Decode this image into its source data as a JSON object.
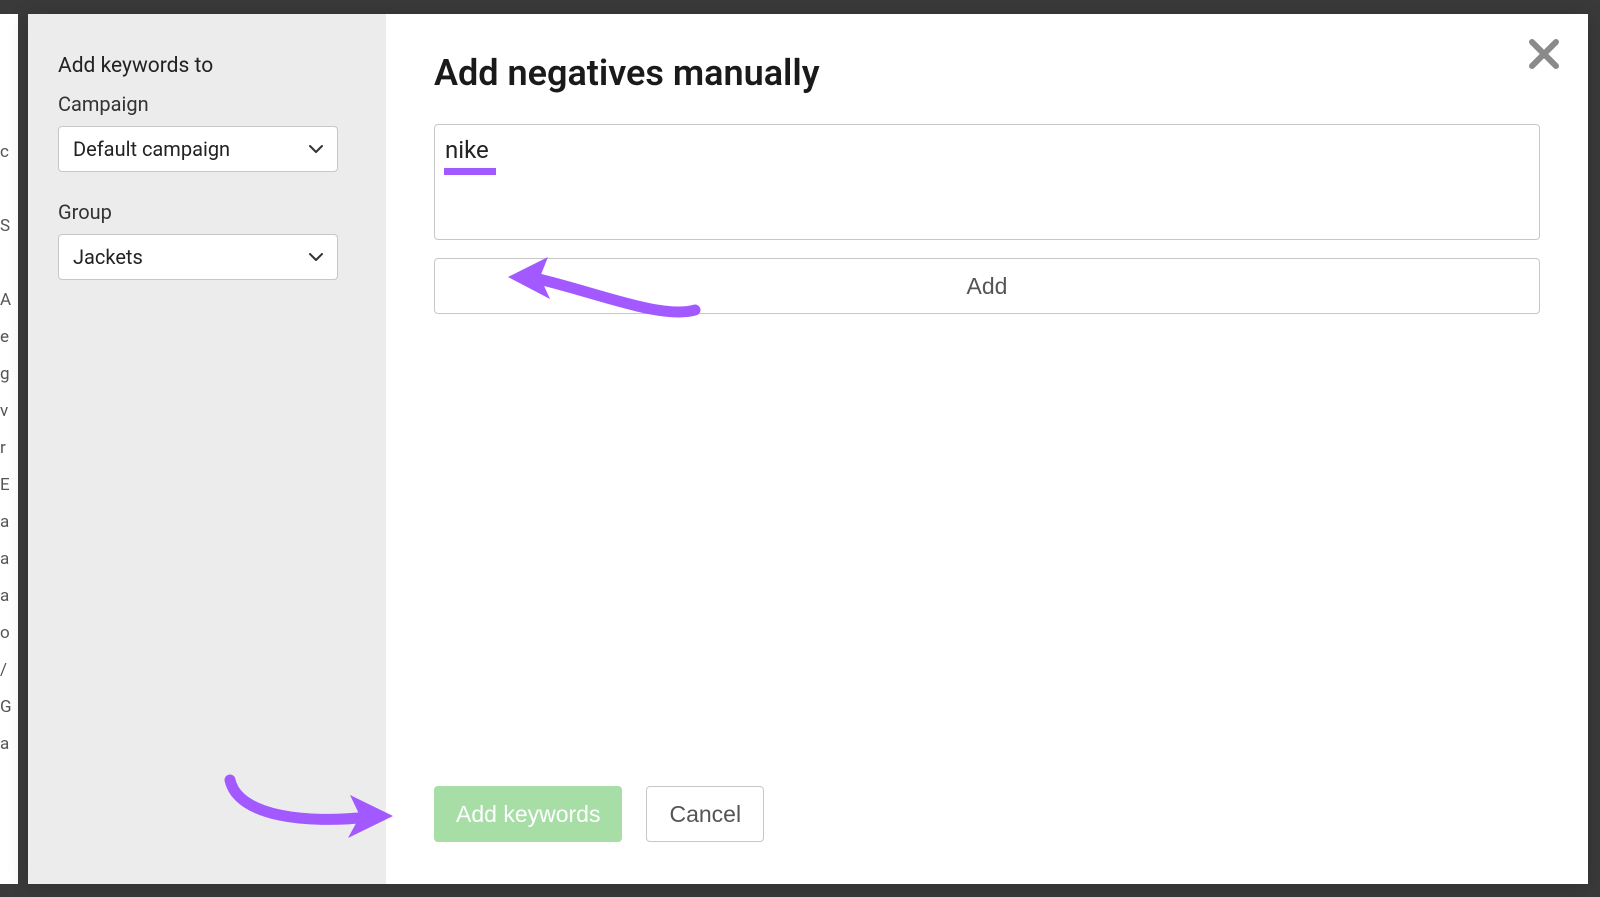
{
  "sidebar": {
    "heading": "Add keywords to",
    "campaign_label": "Campaign",
    "campaign_value": "Default campaign",
    "group_label": "Group",
    "group_value": "Jackets"
  },
  "main": {
    "title": "Add negatives manually",
    "keyword_input": "nike",
    "add_btn": "Add"
  },
  "footer": {
    "primary": "Add keywords",
    "cancel": "Cancel"
  },
  "colors": {
    "annotation_purple": "#a259ff",
    "primary_green": "#a6dea6"
  }
}
